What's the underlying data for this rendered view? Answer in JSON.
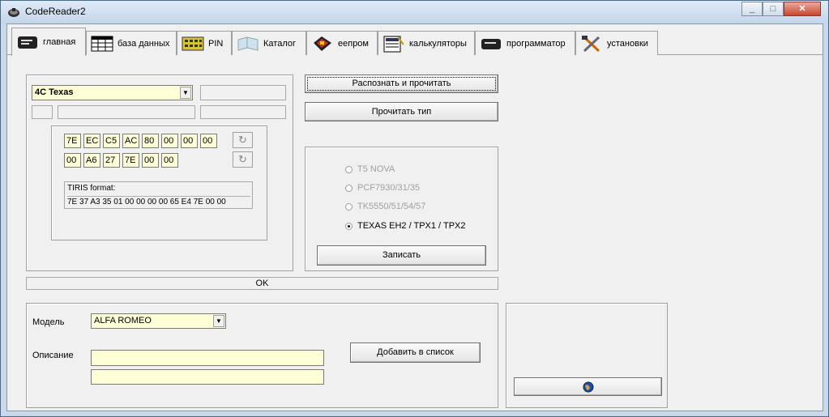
{
  "window": {
    "title": "CodeReader2",
    "min_glyph": "_",
    "max_glyph": "□",
    "close_glyph": "✕"
  },
  "tabs": [
    {
      "label": "главная",
      "icon": "main-icon",
      "active": true
    },
    {
      "label": "база данных",
      "icon": "database-icon",
      "active": false
    },
    {
      "label": "PIN",
      "icon": "pin-keypad-icon",
      "active": false
    },
    {
      "label": "Каталог",
      "icon": "catalog-icon",
      "active": false
    },
    {
      "label": "eeпром",
      "icon": "eeprom-icon",
      "active": false
    },
    {
      "label": "калькуляторы",
      "icon": "calculator-icon",
      "active": false
    },
    {
      "label": "программатор",
      "icon": "programmer-icon",
      "active": false
    },
    {
      "label": "установки",
      "icon": "tools-icon",
      "active": false
    }
  ],
  "transponder": {
    "type_select": "4C Texas",
    "hex_row1": [
      "7E",
      "EC",
      "C5",
      "AC",
      "80",
      "00",
      "00",
      "00"
    ],
    "hex_row2": [
      "00",
      "A6",
      "27",
      "7E",
      "00",
      "00"
    ],
    "tiris_label": "TIRIS format:",
    "tiris_value": "7E 37 A3 35 01 00 00 00 00 65 E4 7E 00 00"
  },
  "actions": {
    "recognize_read": "Распознать и прочитать",
    "read_type": "Прочитать тип"
  },
  "write_group": {
    "options": [
      {
        "label": "T5 NOVA",
        "enabled": false,
        "selected": false
      },
      {
        "label": "PCF7930/31/35",
        "enabled": false,
        "selected": false
      },
      {
        "label": "TK5550/51/54/57",
        "enabled": false,
        "selected": false
      },
      {
        "label": "TEXAS EH2 / TPX1 / TPX2",
        "enabled": true,
        "selected": true
      }
    ],
    "write_button": "Записать"
  },
  "status": "OK",
  "vehicle": {
    "model_label": "Модель",
    "model_value": "ALFA ROMEO",
    "description_label": "Описание",
    "add_button": "Добавить в список"
  },
  "colors": {
    "field_yellow": "#ffffd7",
    "window_bg": "#f0f0f0"
  }
}
